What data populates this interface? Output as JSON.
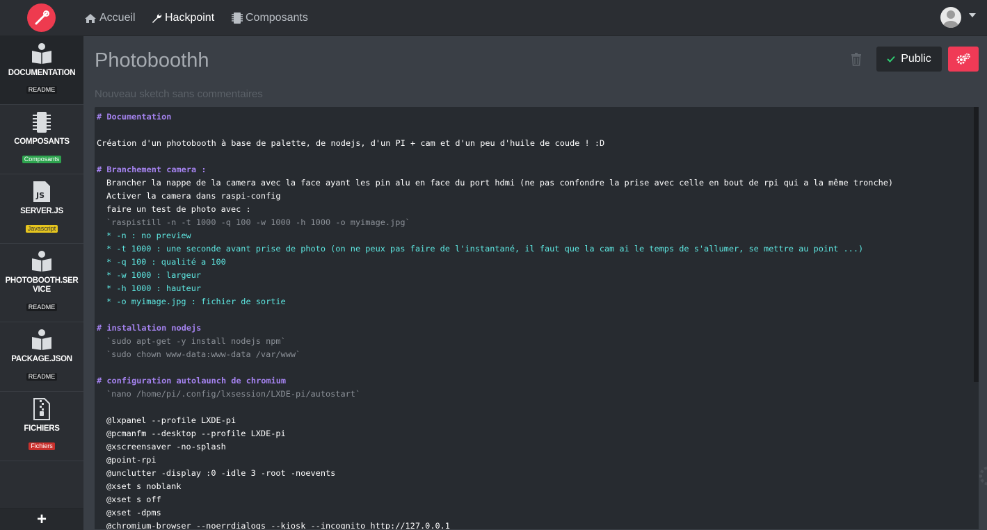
{
  "nav": {
    "items": [
      {
        "label": "Accueil",
        "icon": "home-icon"
      },
      {
        "label": "Hackpoint",
        "icon": "wrench-icon"
      },
      {
        "label": "Composants",
        "icon": "chip-icon"
      }
    ]
  },
  "sidebar": {
    "items": [
      {
        "label": "DOCUMENTATION",
        "badge": "README",
        "badge_color": "#1a1c1f",
        "icon": "book-reader-icon"
      },
      {
        "label": "COMPOSANTS",
        "badge": "Composants",
        "badge_color": "#2ea44f",
        "icon": "chip-icon"
      },
      {
        "label": "SERVER.JS",
        "badge": "Javascript",
        "badge_color": "#e6c51e",
        "icon": "js-file-icon"
      },
      {
        "label": "PHOTOBOOTH.SERVICE",
        "badge": "README",
        "badge_color": "#1a1c1f",
        "icon": "book-reader-icon"
      },
      {
        "label": "PACKAGE.JSON",
        "badge": "README",
        "badge_color": "#1a1c1f",
        "icon": "book-reader-icon"
      },
      {
        "label": "FICHIERS",
        "badge": "Fichiers",
        "badge_color": "#c9302c",
        "icon": "zip-file-icon"
      }
    ],
    "add_label": "+"
  },
  "sketch": {
    "title": "Photoboothh",
    "description": "Nouveau sketch sans commentaires",
    "public_label": "Public"
  },
  "editor": {
    "lines": [
      {
        "t": "head",
        "text": "# Documentation"
      },
      {
        "t": "blank",
        "text": ""
      },
      {
        "t": "text",
        "text": "Création d'un photobooth à base de palette, de nodejs, d'un PI + cam et d'un peu d'huile de coude ! :D"
      },
      {
        "t": "blank",
        "text": ""
      },
      {
        "t": "head",
        "text": "# Branchement camera :"
      },
      {
        "t": "text",
        "ind": 1,
        "text": "Brancher la nappe de la camera avec la face ayant les pin alu en face du port hdmi (ne pas confondre la prise avec celle en bout de rpi qui a la même tronche)"
      },
      {
        "t": "text",
        "ind": 1,
        "text": "Activer la camera dans raspi-config"
      },
      {
        "t": "text",
        "ind": 1,
        "text": "faire un test de photo avec :"
      },
      {
        "t": "code",
        "ind": 1,
        "text": "`raspistill -n -t 1000 -q 100 -w 1000 -h 1000 -o myimage.jpg`"
      },
      {
        "t": "list",
        "ind": 1,
        "text": "* -n : no preview"
      },
      {
        "t": "list",
        "ind": 1,
        "text": "* -t 1000 : une seconde avant prise de photo (on ne peux pas faire de l'instantané, il faut que la cam ai le temps de s'allumer, se mettre au point ...)"
      },
      {
        "t": "list",
        "ind": 1,
        "text": "* -q 100 : qualité a 100"
      },
      {
        "t": "list",
        "ind": 1,
        "text": "* -w 1000 : largeur"
      },
      {
        "t": "list",
        "ind": 1,
        "text": "* -h 1000 : hauteur"
      },
      {
        "t": "list",
        "ind": 1,
        "text": "* -o myimage.jpg : fichier de sortie"
      },
      {
        "t": "blank",
        "text": ""
      },
      {
        "t": "head",
        "text": "# installation nodejs"
      },
      {
        "t": "code",
        "ind": 1,
        "text": "`sudo apt-get -y install nodejs npm`"
      },
      {
        "t": "code",
        "ind": 1,
        "text": "`sudo chown www-data:www-data /var/www`"
      },
      {
        "t": "blank",
        "text": ""
      },
      {
        "t": "head",
        "text": "# configuration autolaunch de chromium"
      },
      {
        "t": "code",
        "ind": 1,
        "text": "`nano /home/pi/.config/lxsession/LXDE-pi/autostart`"
      },
      {
        "t": "blank",
        "text": ""
      },
      {
        "t": "text",
        "ind": 1,
        "text": "@lxpanel --profile LXDE-pi"
      },
      {
        "t": "text",
        "ind": 1,
        "text": "@pcmanfm --desktop --profile LXDE-pi"
      },
      {
        "t": "text",
        "ind": 1,
        "text": "@xscreensaver -no-splash"
      },
      {
        "t": "text",
        "ind": 1,
        "text": "@point-rpi"
      },
      {
        "t": "text",
        "ind": 1,
        "text": "@unclutter -display :0 -idle 3 -root -noevents"
      },
      {
        "t": "text",
        "ind": 1,
        "text": "@xset s noblank"
      },
      {
        "t": "text",
        "ind": 1,
        "text": "@xset s off"
      },
      {
        "t": "text",
        "ind": 1,
        "text": "@xset -dpms"
      },
      {
        "t": "text",
        "ind": 1,
        "text": "@chromium-browser --noerrdialogs --kiosk --incognito http://127.0.0.1"
      }
    ]
  },
  "colors": {
    "accent": "#f03a56",
    "heading": "#a583f0",
    "list": "#5ee8e2",
    "code": "#8c9198"
  }
}
